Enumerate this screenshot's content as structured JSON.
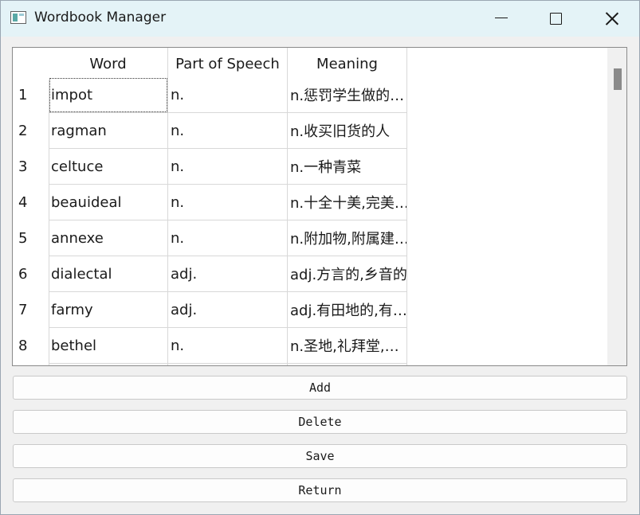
{
  "window": {
    "title": "Wordbook Manager",
    "icons": {
      "app": "app-icon",
      "minimize": "minimize-icon",
      "maximize": "maximize-icon",
      "close": "close-icon"
    }
  },
  "table": {
    "columns": [
      "Word",
      "Part of Speech",
      "Meaning"
    ],
    "rows": [
      {
        "num": "1",
        "word": "impot",
        "pos": "n.",
        "meaning": "n.惩罚学生做的…"
      },
      {
        "num": "2",
        "word": "ragman",
        "pos": "n.",
        "meaning": "n.收买旧货的人"
      },
      {
        "num": "3",
        "word": "celtuce",
        "pos": "n.",
        "meaning": "n.一种青菜"
      },
      {
        "num": "4",
        "word": "beauideal",
        "pos": "n.",
        "meaning": "n.十全十美,完美…"
      },
      {
        "num": "5",
        "word": "annexe",
        "pos": "n.",
        "meaning": "n.附加物,附属建…"
      },
      {
        "num": "6",
        "word": "dialectal",
        "pos": "adj.",
        "meaning": "adj.方言的,乡音的"
      },
      {
        "num": "7",
        "word": "farmy",
        "pos": "adj.",
        "meaning": "adj.有田地的,有…"
      },
      {
        "num": "8",
        "word": "bethel",
        "pos": "n.",
        "meaning": "n.圣地,礼拜堂,…"
      }
    ]
  },
  "buttons": {
    "add": "Add",
    "delete": "Delete",
    "save": "Save",
    "return": "Return"
  }
}
